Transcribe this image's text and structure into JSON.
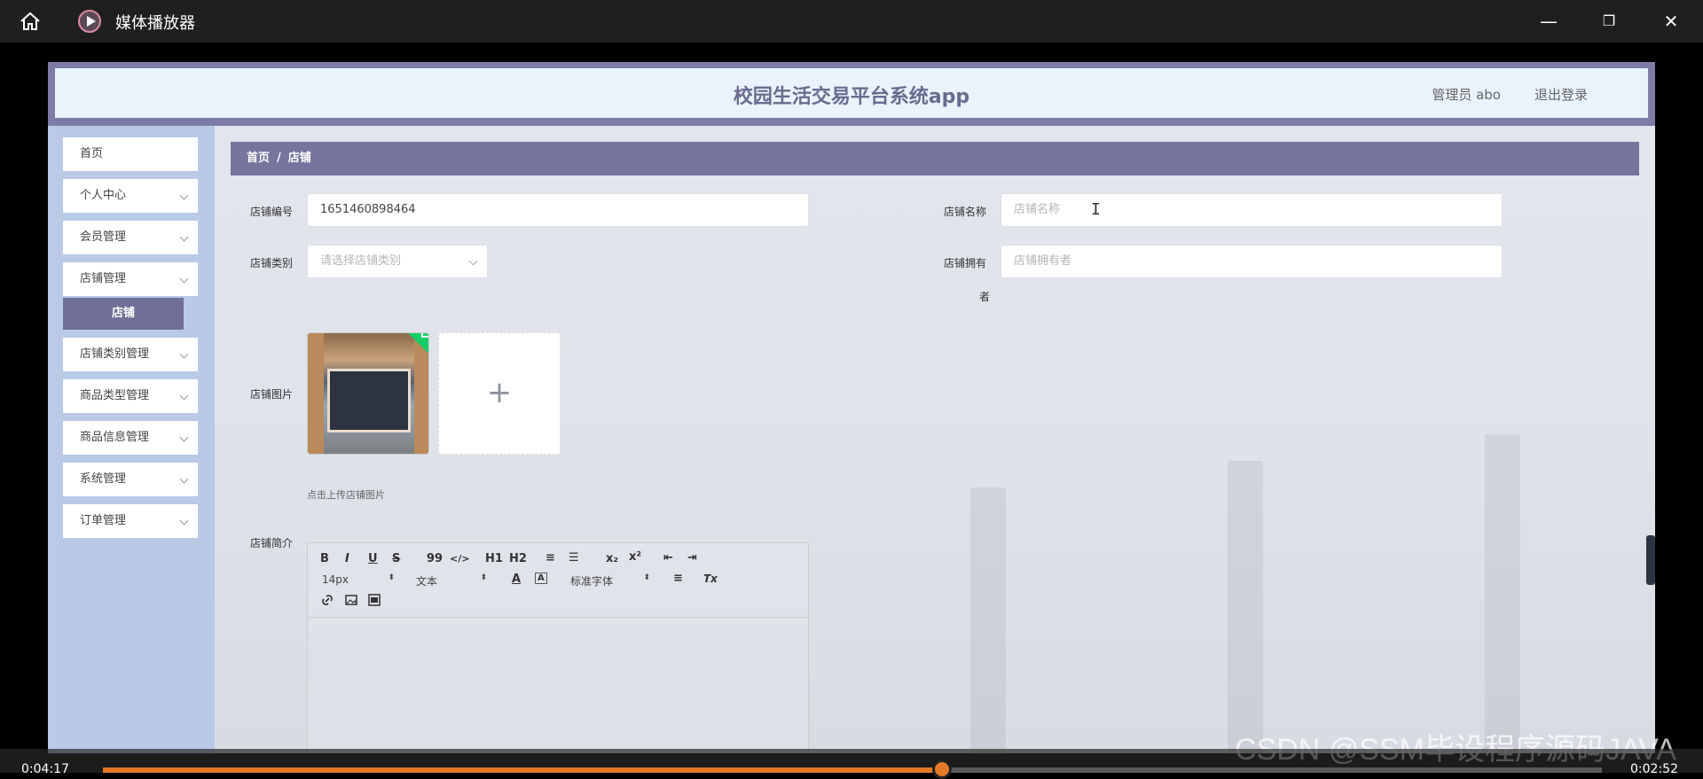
{
  "player": {
    "title": "媒体播放器",
    "minimize_label": "—",
    "restore_label": "❐",
    "close_label": "✕",
    "time_elapsed": "0:04:17",
    "time_remaining": "0:02:52",
    "progress": 0.56,
    "watermark": "CSDN @SSM毕设程序源码JAVA"
  },
  "header": {
    "title": "校园生活交易平台系统app",
    "admin_label": "管理员 abo",
    "logout_label": "退出登录"
  },
  "sidebar": {
    "items": [
      {
        "label": "首页",
        "has_chevron": false
      },
      {
        "label": "个人中心",
        "has_chevron": true
      },
      {
        "label": "会员管理",
        "has_chevron": true
      },
      {
        "label": "店铺管理",
        "has_chevron": true
      },
      {
        "label": "店铺类别管理",
        "has_chevron": true
      },
      {
        "label": "商品类型管理",
        "has_chevron": true
      },
      {
        "label": "商品信息管理",
        "has_chevron": true
      },
      {
        "label": "系统管理",
        "has_chevron": true
      },
      {
        "label": "订单管理",
        "has_chevron": true
      }
    ],
    "active_sub": "店铺"
  },
  "breadcrumb": {
    "home": "首页",
    "separator": "/",
    "current": "店铺"
  },
  "form": {
    "shop_no_label": "店铺编号",
    "shop_no_value": "1651460898464",
    "shop_name_label": "店铺名称",
    "shop_name_placeholder": "店铺名称",
    "shop_category_label": "店铺类别",
    "shop_category_placeholder": "请选择店铺类别",
    "shop_owner_label_line1": "店铺拥有",
    "shop_owner_label_line2": "者",
    "shop_owner_placeholder": "店铺拥有者",
    "shop_image_label": "店铺图片",
    "upload_add_symbol": "+",
    "upload_hint": "点击上传店铺图片",
    "shop_intro_label": "店铺简介"
  },
  "editor": {
    "bold": "B",
    "italic": "I",
    "underline": "U",
    "strike": "S",
    "quote": "99",
    "code": "</>",
    "h1": "H1",
    "h2": "H2",
    "ordered_list": "≡",
    "bullet_list": "☰",
    "subscript": "x₂",
    "superscript": "x²",
    "outdent": "⇤",
    "indent": "⇥",
    "font_size": "14px",
    "text_style": "文本",
    "font_family": "标准字体",
    "font_color": "A",
    "bg_color": "A",
    "align": "≡",
    "clear": "Tx"
  }
}
